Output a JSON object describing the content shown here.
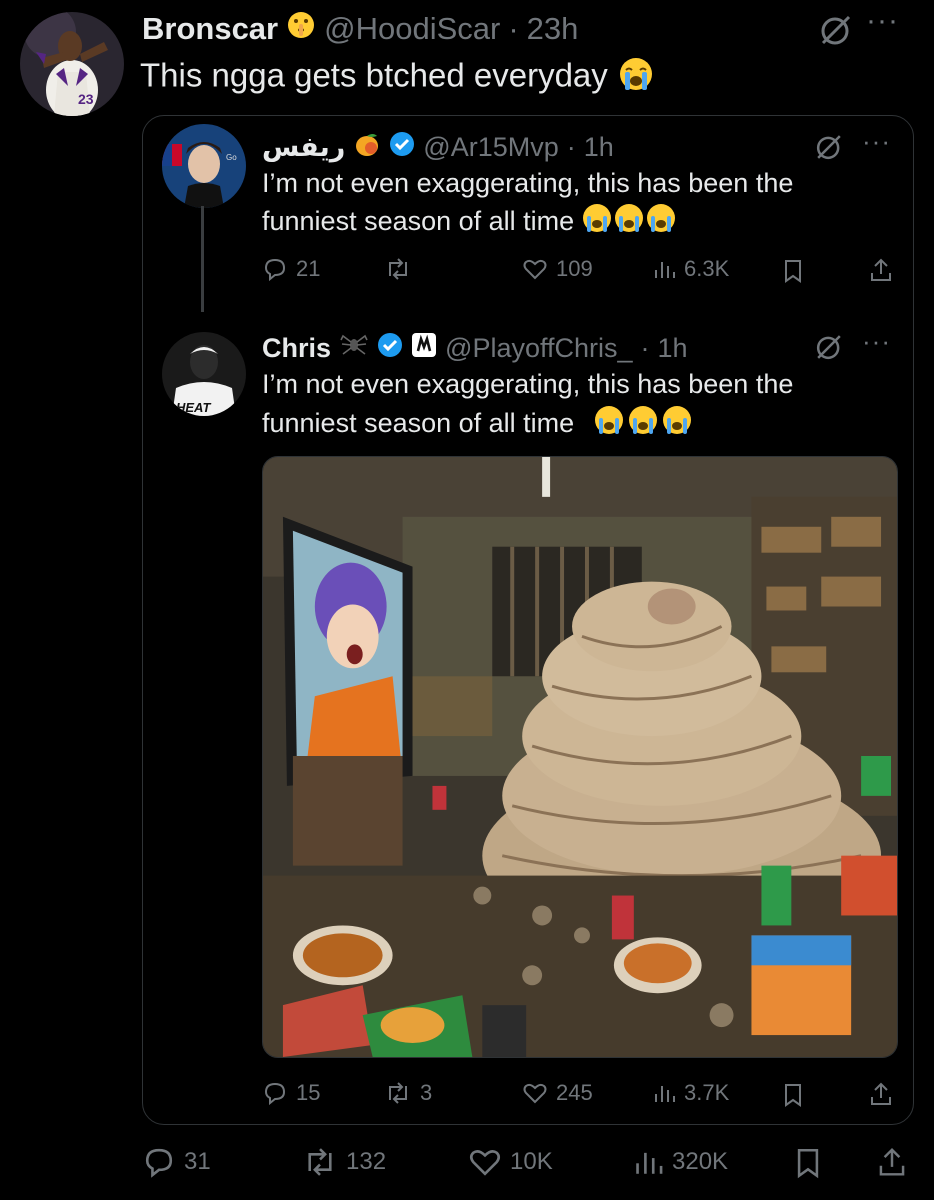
{
  "main_tweet": {
    "display_name": "Bronscar",
    "name_emoji": "shushing-face-emoji",
    "handle": "@HoodiScar",
    "separator": "·",
    "time": "23h",
    "text": "This ngga gets btched everyday",
    "text_emoji": "loudly-crying-face-emoji",
    "actions": {
      "replies": "31",
      "reposts": "132",
      "likes": "10K",
      "views": "320K"
    }
  },
  "quoted_tweet_1": {
    "display_name": "ريفس",
    "name_emoji": "mango-emoji",
    "verified": true,
    "handle": "@Ar15Mvp",
    "separator": "·",
    "time": "1h",
    "text": "I’m not even exaggerating, this has been the funniest season of all time",
    "text_emoji": "loudly-crying-face-emoji",
    "actions": {
      "replies": "21",
      "reposts": "",
      "likes": "109",
      "views": "6.3K"
    }
  },
  "quoted_tweet_2": {
    "display_name": "Chris",
    "name_emoji": "spider-emoji",
    "verified": true,
    "handle": "@PlayoffChris_",
    "separator": "·",
    "time": "1h",
    "text": "I’m not even exaggerating, this has been the funniest season of all time",
    "text_emoji": "loudly-crying-face-emoji",
    "actions": {
      "replies": "15",
      "reposts": "3",
      "likes": "245",
      "views": "3.7K"
    }
  },
  "colors": {
    "background": "#000000",
    "text": "#e7e9ea",
    "muted": "#71767b",
    "border": "#2f3336",
    "verified_blue": "#1d9bf0"
  }
}
